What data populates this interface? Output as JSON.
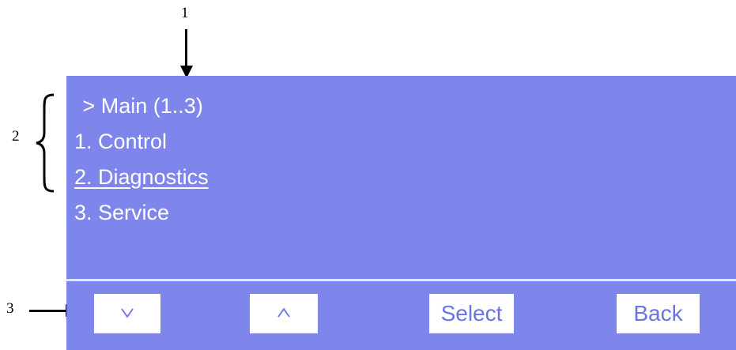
{
  "callouts": [
    "1",
    "2",
    "3"
  ],
  "menu": {
    "header": " > Main (1..3)",
    "items": [
      "1. Control",
      "2. Diagnostics",
      "3. Service"
    ],
    "highlighted_index": 1
  },
  "softkeys": {
    "down": {
      "icon": "chevron-down-icon"
    },
    "up": {
      "icon": "chevron-up-icon"
    },
    "select": "Select",
    "back": "Back"
  },
  "colors": {
    "screen_background": "#7e86ec",
    "menu_text": "#ffffff",
    "softkey_background": "#ffffff",
    "softkey_text": "#6a73e6",
    "divider": "#e6e6f6"
  }
}
